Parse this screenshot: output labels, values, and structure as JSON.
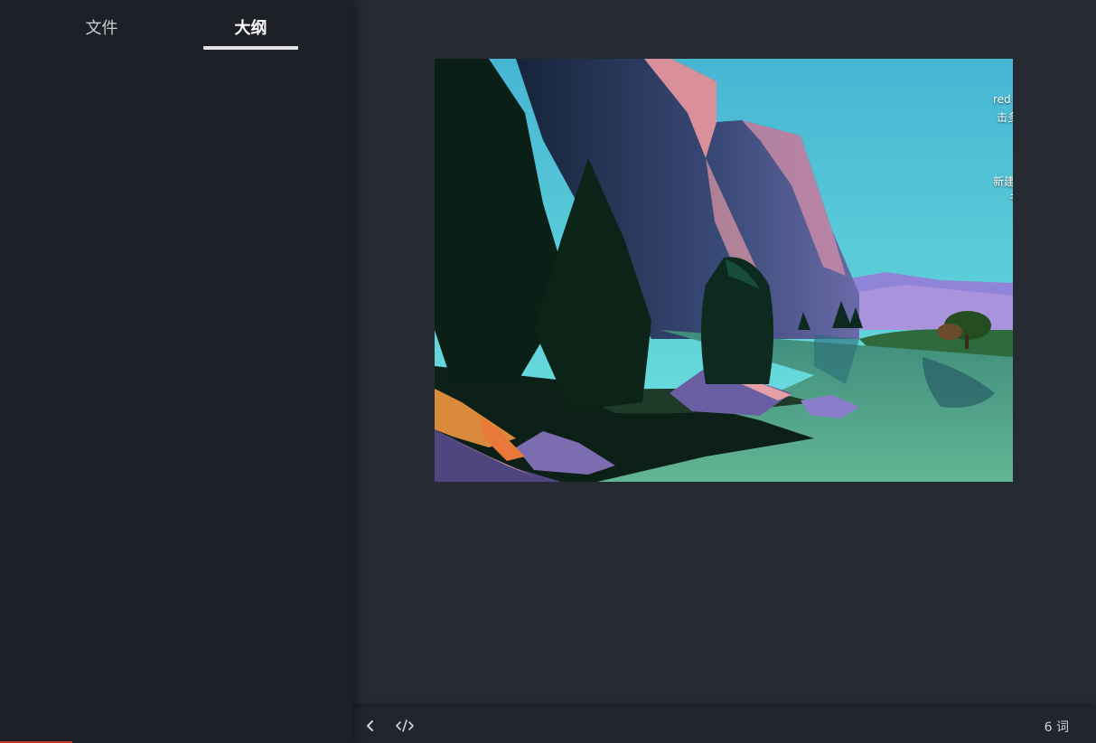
{
  "sidebar": {
    "tabs": [
      {
        "label": "文件",
        "active": false
      },
      {
        "label": "大纲",
        "active": true
      }
    ]
  },
  "editor": {
    "image": {
      "desktop_labels": [
        "red",
        "击多",
        "新建",
        "书"
      ]
    }
  },
  "statusbar": {
    "back_icon": "chevron-left-icon",
    "source_icon": "code-icon",
    "word_count": "6 词"
  },
  "colors": {
    "sidebar_bg": "#1e2028",
    "main_bg": "#262a33",
    "statusbar_bg": "#22252d",
    "active_tab_text": "#ffffff",
    "tab_underline": "#e3e3e3"
  }
}
